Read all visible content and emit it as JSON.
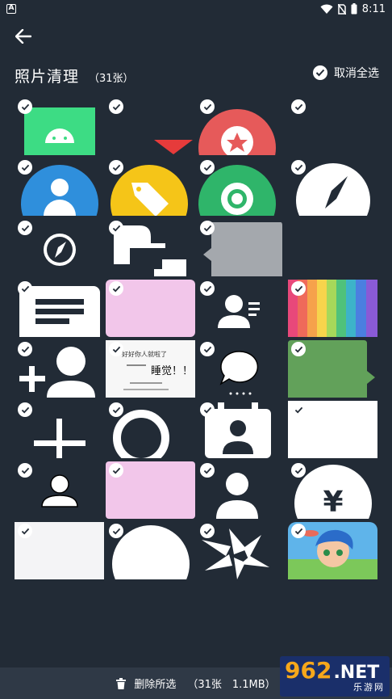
{
  "status_bar": {
    "app_badge": "A",
    "time": "8:11"
  },
  "header": {
    "title": "照片清理",
    "count": "（31张）",
    "deselect_all": "取消全选"
  },
  "grid": {
    "items": [
      {
        "name": "android-icon-image",
        "selected": true
      },
      {
        "name": "red-triangle-image",
        "selected": true
      },
      {
        "name": "red-star-circle-image",
        "selected": true
      },
      {
        "name": "blank-dark-image",
        "selected": true
      },
      {
        "name": "blue-contact-circle-image",
        "selected": true
      },
      {
        "name": "yellow-tag-circle-image",
        "selected": true
      },
      {
        "name": "green-camera-circle-image",
        "selected": true
      },
      {
        "name": "white-compass-image",
        "selected": true
      },
      {
        "name": "small-compass-image",
        "selected": true
      },
      {
        "name": "white-cap-shape-image",
        "selected": true
      },
      {
        "name": "gray-speech-shape-image",
        "selected": true
      },
      {
        "name": "dark-empty-image",
        "selected": false
      },
      {
        "name": "white-message-lines-image",
        "selected": true
      },
      {
        "name": "pink-card-image",
        "selected": true
      },
      {
        "name": "person-list-image",
        "selected": true
      },
      {
        "name": "rainbow-stripes-image",
        "selected": true
      },
      {
        "name": "add-person-image",
        "selected": true
      },
      {
        "name": "handwritten-note-image",
        "selected": true
      },
      {
        "name": "chat-bubble-image",
        "selected": true
      },
      {
        "name": "green-bubble-image",
        "selected": true
      },
      {
        "name": "plus-sign-image",
        "selected": true
      },
      {
        "name": "white-ring-image",
        "selected": true
      },
      {
        "name": "calendar-person-image",
        "selected": true
      },
      {
        "name": "white-blank-image",
        "selected": true
      },
      {
        "name": "person-silhouette-image",
        "selected": true
      },
      {
        "name": "pink-card-2-image",
        "selected": true
      },
      {
        "name": "white-person-image",
        "selected": true
      },
      {
        "name": "yen-circle-image",
        "selected": true
      },
      {
        "name": "white-noise-image",
        "selected": true
      },
      {
        "name": "white-circle-image",
        "selected": true
      },
      {
        "name": "aperture-image",
        "selected": true
      },
      {
        "name": "cartoon-game-image",
        "selected": true
      }
    ],
    "note_text": {
      "line1": "好好你人就啦了",
      "line2": "睡觉！！"
    }
  },
  "bottom": {
    "delete_label": "删除所选",
    "summary": "（31张　1.1MB）"
  },
  "watermark": {
    "big": "962",
    "net": ".NET",
    "sub": "乐游网"
  },
  "colors": {
    "background": "#222b36",
    "bottom_bar": "#2f3946",
    "android_green": "#3ddc84",
    "red": "#e65a5a",
    "blue": "#2f8fdc",
    "yellow": "#f5c518",
    "green": "#2fb56a",
    "pink": "#f2c6ea",
    "gray": "#a4a8ad"
  },
  "icons": [
    "back-arrow-icon",
    "check-icon",
    "trash-icon",
    "wifi-icon",
    "battery-icon"
  ]
}
